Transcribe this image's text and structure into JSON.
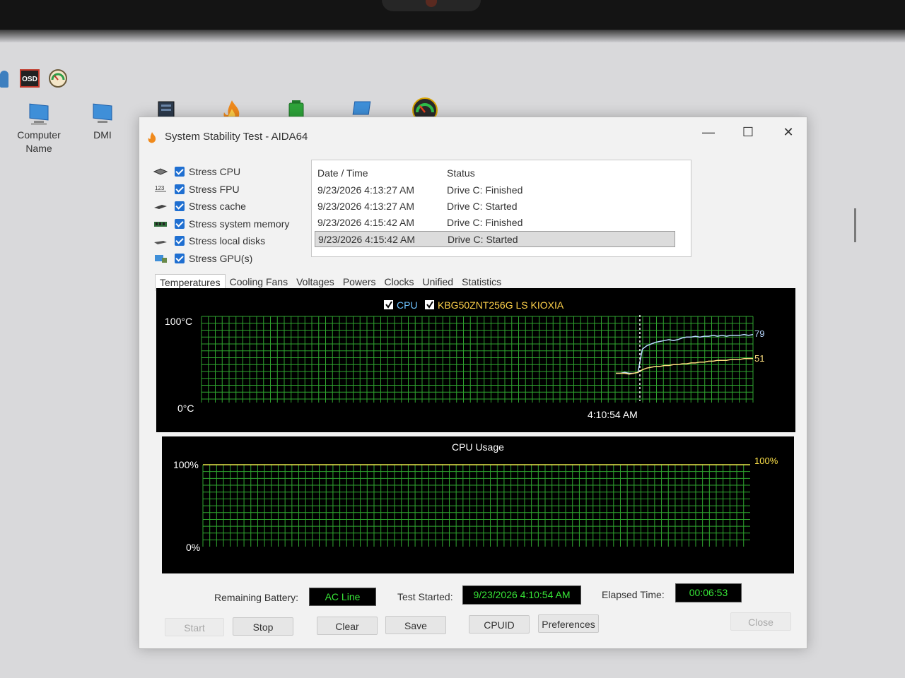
{
  "desktop": {
    "toolbar": [
      {
        "name": "user-icon"
      },
      {
        "name": "osd-icon",
        "text": "OSD"
      },
      {
        "name": "gauge-icon"
      }
    ],
    "icons": [
      {
        "label": "Computer\nName",
        "icon": "computer-icon"
      },
      {
        "label": "DMI",
        "icon": "computer-icon"
      },
      {
        "label": "",
        "icon": "server-icon"
      },
      {
        "label": "",
        "icon": "flame-icon"
      },
      {
        "label": "",
        "icon": "battery-icon"
      },
      {
        "label": "",
        "icon": "laptop-icon"
      },
      {
        "label": "",
        "icon": "gauge-icon"
      }
    ]
  },
  "window": {
    "title": "System Stability Test - AIDA64",
    "controls": {
      "minimize": "—",
      "maximize": "☐",
      "close": "✕"
    }
  },
  "stress": [
    {
      "label": "Stress CPU",
      "checked": true,
      "icon": "cpu-icon"
    },
    {
      "label": "Stress FPU",
      "checked": true,
      "icon": "fpu-icon"
    },
    {
      "label": "Stress cache",
      "checked": true,
      "icon": "cache-icon"
    },
    {
      "label": "Stress system memory",
      "checked": true,
      "icon": "memory-icon"
    },
    {
      "label": "Stress local disks",
      "checked": true,
      "icon": "disk-icon"
    },
    {
      "label": "Stress GPU(s)",
      "checked": true,
      "icon": "gpu-icon"
    }
  ],
  "log": {
    "headers": [
      "Date / Time",
      "Status"
    ],
    "rows": [
      {
        "time": "9/23/2026 4:13:27 AM",
        "status": "Drive C: Finished"
      },
      {
        "time": "9/23/2026 4:13:27 AM",
        "status": "Drive C: Started"
      },
      {
        "time": "9/23/2026 4:15:42 AM",
        "status": "Drive C: Finished"
      },
      {
        "time": "9/23/2026 4:15:42 AM",
        "status": "Drive C: Started",
        "selected": true
      }
    ]
  },
  "tabs": [
    "Temperatures",
    "Cooling Fans",
    "Voltages",
    "Powers",
    "Clocks",
    "Unified",
    "Statistics"
  ],
  "active_tab": "Temperatures",
  "chart_data": [
    {
      "type": "line",
      "title": "",
      "legend": [
        {
          "name": "CPU",
          "checked": true,
          "color": "#ffffff"
        },
        {
          "name": "KBG50ZNT256G LS KIOXIA",
          "checked": true,
          "color": "#ffd24a"
        }
      ],
      "y_max_label": "100°C",
      "y_min_label": "0°C",
      "ylim": [
        0,
        100
      ],
      "marker_label": "4:10:54 AM",
      "series": [
        {
          "name": "CPU",
          "color": "#b8d8ff",
          "values": [
            34,
            34,
            35,
            34,
            34,
            35,
            62,
            66,
            68,
            70,
            71,
            72,
            73,
            72,
            73,
            75,
            76,
            76,
            77,
            76,
            77,
            77,
            78,
            77,
            78,
            77,
            78,
            78,
            78,
            79,
            78,
            79
          ]
        },
        {
          "name": "KBG50ZNT256G LS KIOXIA",
          "color": "#ffe080",
          "values": [
            34,
            34,
            34,
            33,
            34,
            35,
            38,
            40,
            41,
            42,
            42,
            43,
            43,
            44,
            44,
            45,
            45,
            46,
            46,
            47,
            47,
            48,
            48,
            49,
            49,
            49,
            50,
            50,
            50,
            51,
            51,
            51
          ]
        }
      ],
      "end_labels": [
        "79",
        "51"
      ]
    },
    {
      "type": "line",
      "title": "CPU Usage",
      "y_max_label": "100%",
      "y_min_label": "0%",
      "ylim": [
        0,
        100
      ],
      "series": [
        {
          "name": "CPU Usage",
          "color": "#e8e84a",
          "values": [
            100,
            100
          ]
        }
      ],
      "end_labels": [
        "100%"
      ]
    }
  ],
  "status": {
    "remaining_battery_label": "Remaining Battery:",
    "remaining_battery": "AC Line",
    "test_started_label": "Test Started:",
    "test_started": "9/23/2026 4:10:54 AM",
    "elapsed_label": "Elapsed Time:",
    "elapsed": "00:06:53"
  },
  "buttons": {
    "start": "Start",
    "stop": "Stop",
    "clear": "Clear",
    "save": "Save",
    "cpuid": "CPUID",
    "preferences": "Preferences",
    "close": "Close"
  }
}
